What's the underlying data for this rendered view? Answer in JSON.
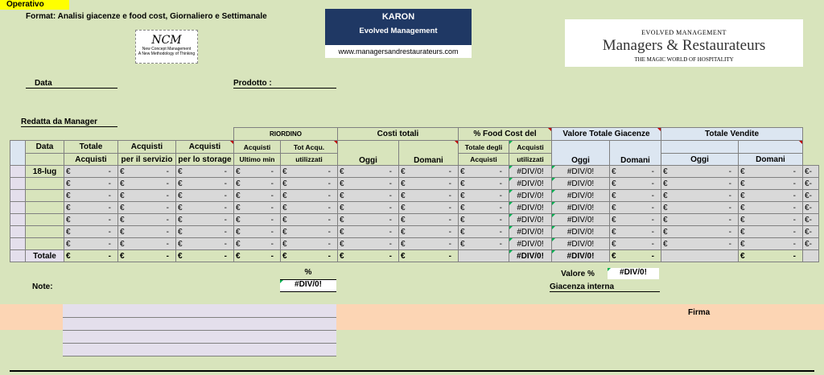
{
  "header": {
    "operativo": "Operativo",
    "format_title": "Format: Analisi giacenze e food cost, Giornaliero e Settimanale"
  },
  "logos": {
    "ncm": {
      "title": "NCM",
      "line1": "New Concept Management",
      "line2": "A New Methodology of Thinking"
    },
    "karon": {
      "title": "KARON",
      "subtitle": "Evolved Management",
      "url": "www.managersandrestaurateurs.com"
    },
    "mr": {
      "top": "EVOLVED MANAGEMENT",
      "name": "Managers & Restaurateurs",
      "tagline": "THE MAGIC WORLD OF HOSPITALITY"
    }
  },
  "fields": {
    "data_label": "Data",
    "prodotto_label": "Prodotto :",
    "redatta_label": "Redatta da Manager"
  },
  "table": {
    "group_headers": {
      "riordino": "RIORDINO",
      "costi_totali": "Costi totali",
      "food_cost": "% Food Cost  del",
      "valore_giacenze": "Valore Totale Giacenze",
      "totale_vendite": "Totale Vendite"
    },
    "col_headers": {
      "data": "Data",
      "totale_acquisti_1": "Totale",
      "totale_acquisti_2": "Acquisti",
      "acq_servizio_1": "Acquisti",
      "acq_servizio_2": "per il servizio",
      "acq_storage_1": "Acquisti",
      "acq_storage_2": "per lo storage",
      "acq_ultimo_1": "Acquisti",
      "acq_ultimo_2": "Ultimo min",
      "tot_acqu_1": "Tot Acqu.",
      "tot_acqu_2": "utilizzati",
      "oggi": "Oggi",
      "domani": "Domani",
      "tot_degli_1": "Totale degli",
      "tot_degli_2": "Acquisti",
      "acq_util_1": "Acquisti",
      "acq_util_2": "utilizzati"
    },
    "currency": "€",
    "dash": "-",
    "div_error": "#DIV/0!",
    "first_date": "18-lug",
    "total_label": "Totale"
  },
  "summary": {
    "percent_label": "%",
    "percent_value": "#DIV/0!",
    "valore_pct_label": "Valore %",
    "valore_pct_value": "#DIV/0!",
    "giacenza_interna": "Giacenza interna",
    "note_label": "Note:",
    "firma_label": "Firma"
  }
}
